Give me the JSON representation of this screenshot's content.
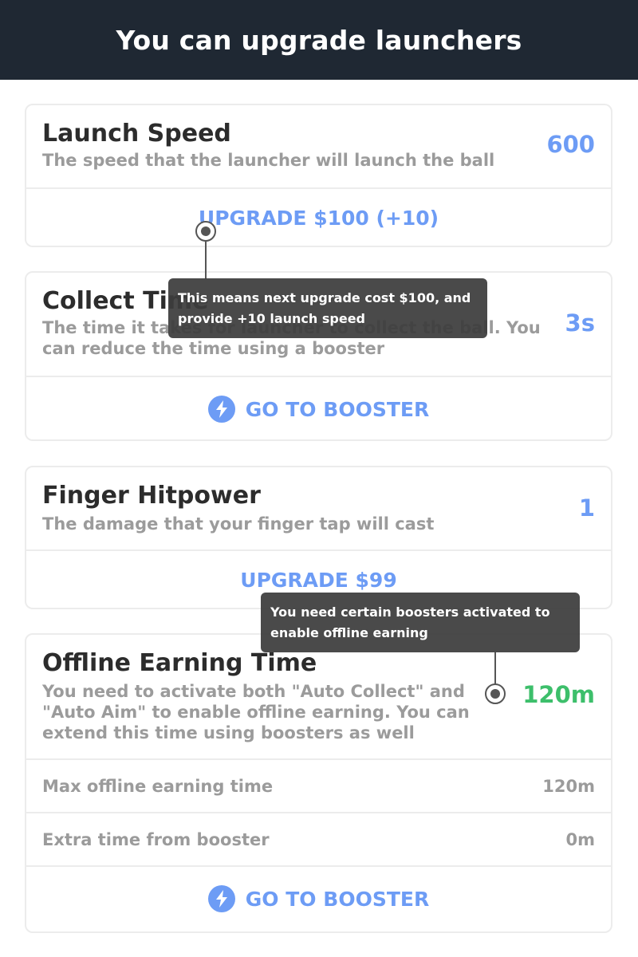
{
  "header": {
    "title": "You can upgrade launchers"
  },
  "cards": {
    "launch_speed": {
      "title": "Launch Speed",
      "description": "The speed that the launcher will launch the ball",
      "value": "600",
      "action_label": "UPGRADE $100 (+10)"
    },
    "collect_time": {
      "title": "Collect Time",
      "description": "The time it takes for launcher to collect the ball. You can reduce the time using a booster",
      "value": "3s",
      "action_label": "GO TO BOOSTER",
      "action_icon": "lightning-bolt-icon"
    },
    "finger_hitpower": {
      "title": "Finger Hitpower",
      "description": "The damage that your finger tap will cast",
      "value": "1",
      "action_label": "UPGRADE $99"
    },
    "offline_earning": {
      "title": "Offline Earning Time",
      "description": "You need to activate both \"Auto Collect\" and \"Auto Aim\" to enable offline earning. You can extend this time using boosters as well",
      "value": "120m",
      "rows": [
        {
          "label": "Max offline earning time",
          "value": "120m"
        },
        {
          "label": "Extra time from booster",
          "value": "0m"
        }
      ],
      "action_label": "GO TO BOOSTER",
      "action_icon": "lightning-bolt-icon"
    }
  },
  "tooltips": {
    "upgrade_hint": "This means next upgrade cost $100, and provide +10 launch speed",
    "offline_hint": "You need certain boosters activated to enable offline earning"
  },
  "colors": {
    "header_bg": "#1f2833",
    "accent": "#6d9cf5",
    "success": "#3dbf6b",
    "muted_text": "#9b9b9b",
    "tooltip_bg": "#3c3c3c"
  }
}
